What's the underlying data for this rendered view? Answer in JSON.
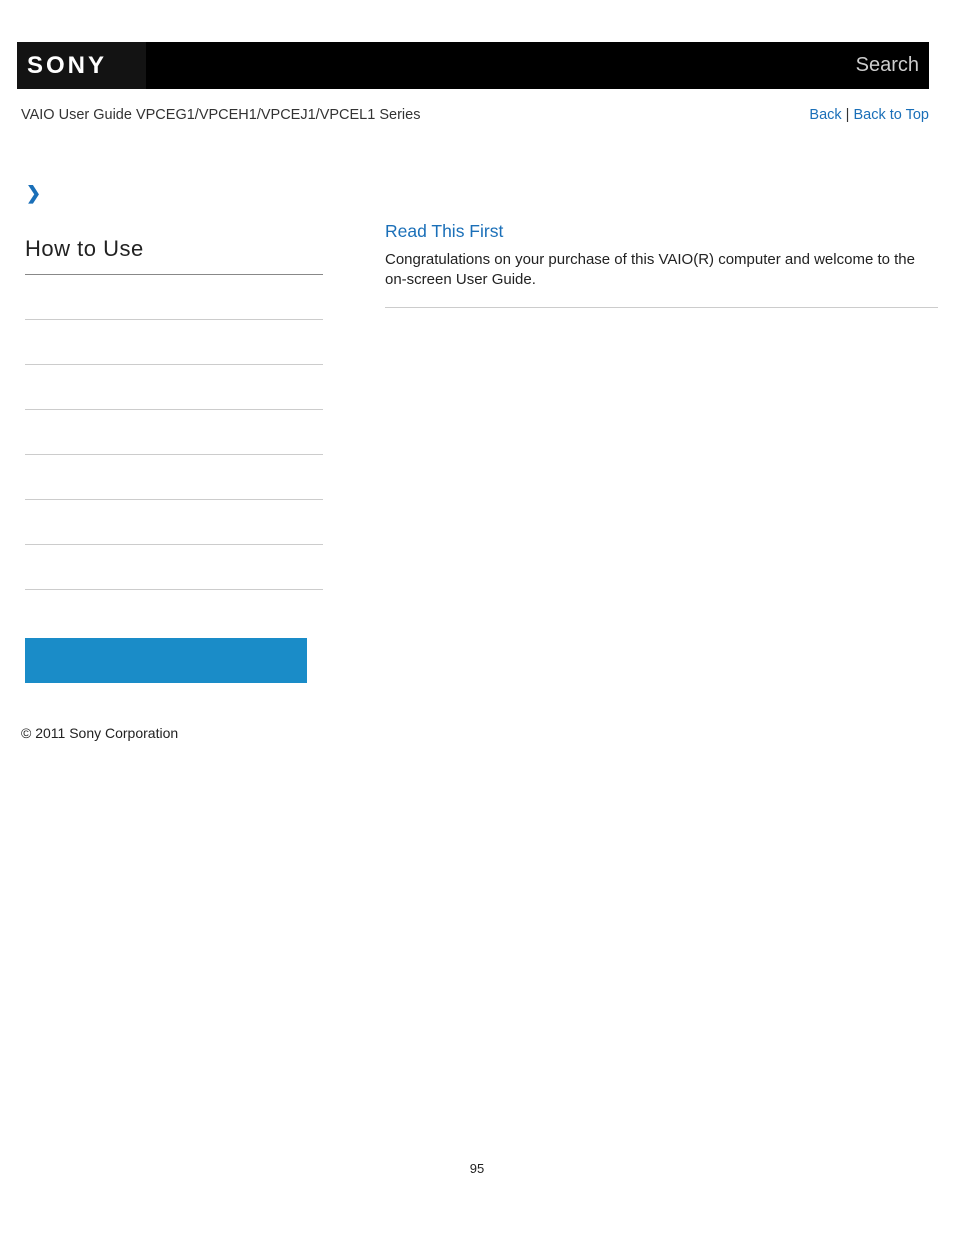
{
  "header": {
    "logo_text": "SONY",
    "search_label": "Search"
  },
  "subheader": {
    "guide_title": "VAIO User Guide VPCEG1/VPCEH1/VPCEJ1/VPCEL1 Series",
    "back_link": "Back",
    "separator": " | ",
    "back_to_top_link": "Back to Top"
  },
  "sidebar": {
    "title": "How to Use"
  },
  "main": {
    "heading": "Read This First",
    "text": "Congratulations on your purchase of this VAIO(R) computer and welcome to the on-screen User Guide."
  },
  "footer": {
    "copyright": "© 2011 Sony Corporation"
  },
  "page_number": "95"
}
